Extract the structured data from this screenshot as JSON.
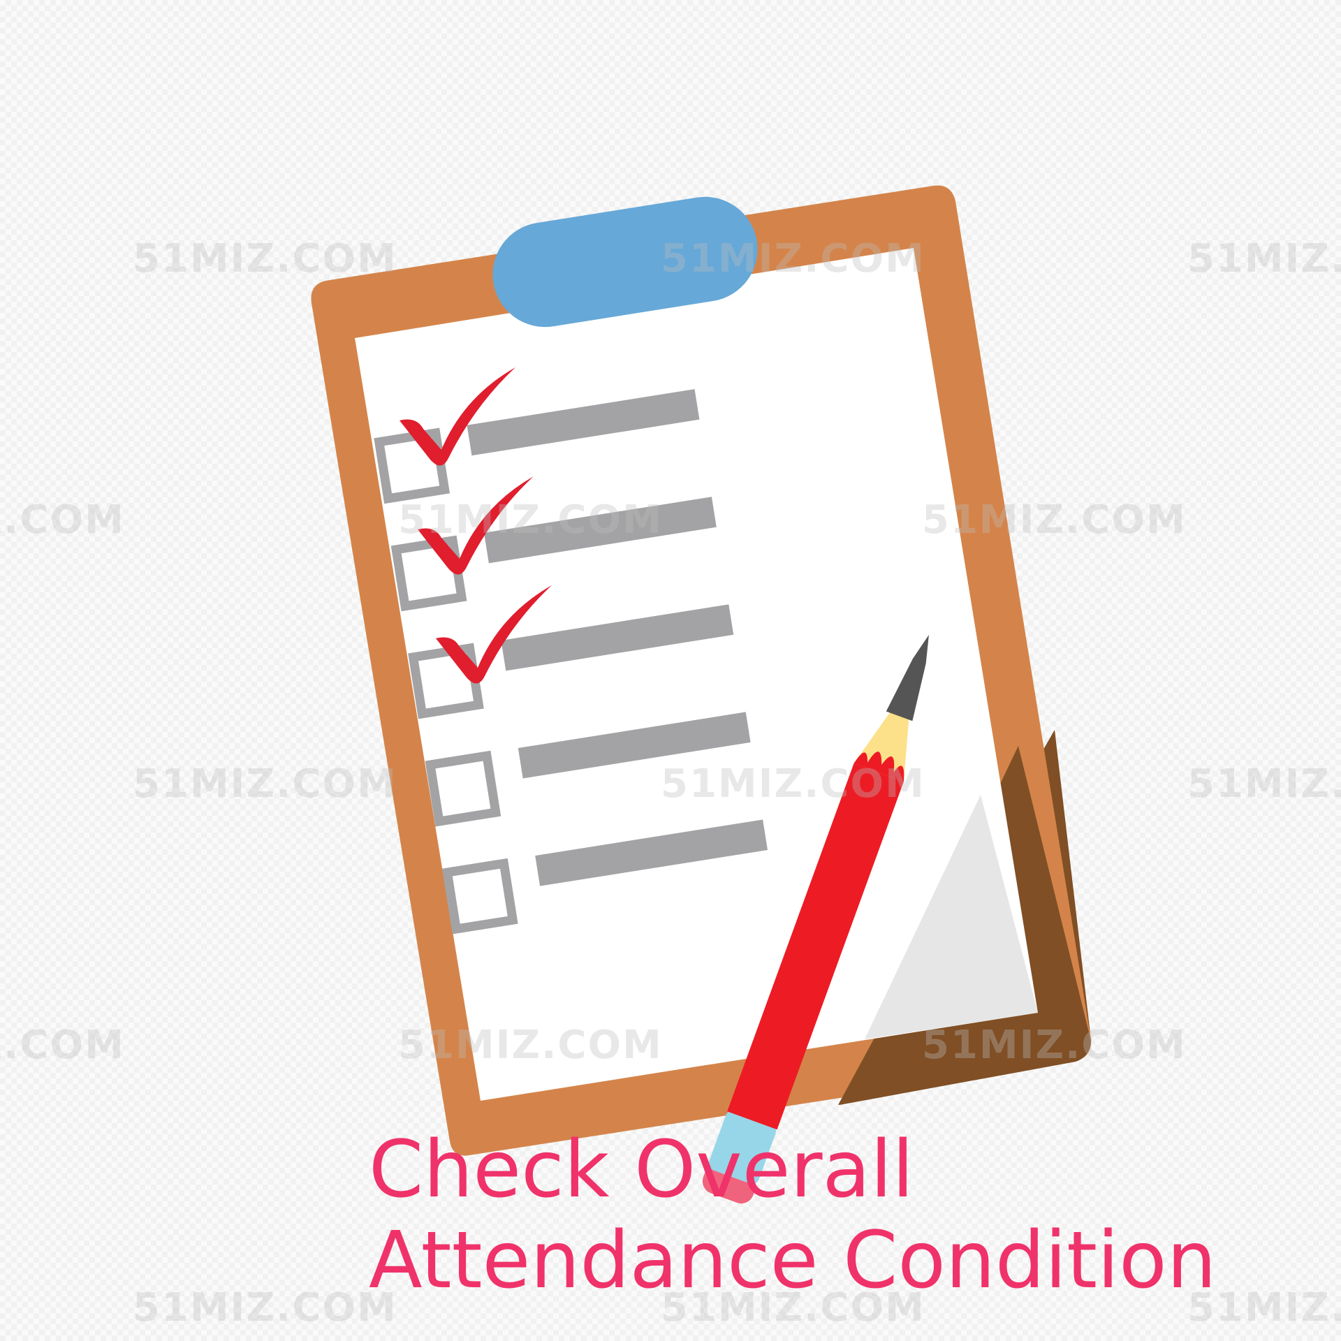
{
  "caption": {
    "line1": "Check Overall",
    "line2": "Attendance Condition"
  },
  "watermark_text": "51MIZ.COM",
  "checklist": {
    "items_total": 5,
    "items_checked": 3
  },
  "icons": [
    "clipboard-icon",
    "checkmark-icon",
    "checkbox-icon",
    "pencil-icon"
  ],
  "colors": {
    "clipboard_board": "#d4844a",
    "clipboard_board_shadow": "#804f25",
    "clip": "#66a8d8",
    "paper": "#ffffff",
    "paper_fold": "#e6e6e6",
    "checkbox_border": "#a3a3a5",
    "line": "#a3a3a5",
    "checkmark": "#e01e2e",
    "pencil_body": "#ed1c24",
    "pencil_wood": "#fde08a",
    "pencil_tip": "#555555",
    "pencil_ferrule": "#97d6e8",
    "caption_text": "#f0326a"
  }
}
